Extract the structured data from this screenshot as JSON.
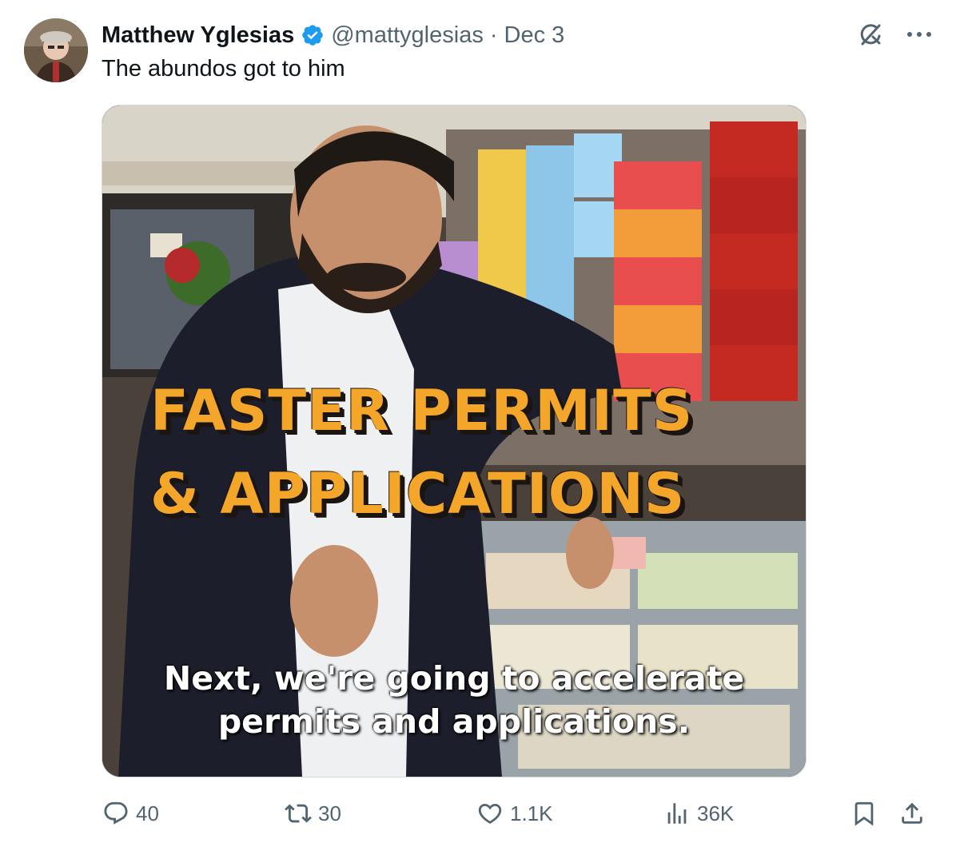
{
  "tweet": {
    "author_name": "Matthew Yglesias",
    "handle": "@mattyglesias",
    "separator": "·",
    "date": "Dec 3",
    "text": "The abundos got to him"
  },
  "media": {
    "caption_line1": "FASTER PERMITS",
    "caption_line2": "& APPLICATIONS",
    "subtitle_line1": "Next, we're going to accelerate",
    "subtitle_line2": "permits and applications."
  },
  "actions": {
    "replies": "40",
    "reposts": "30",
    "likes": "1.1K",
    "views": "36K"
  },
  "icons": {
    "verified": "verified-badge-icon",
    "grok": "grok-icon",
    "more": "more-icon",
    "reply": "reply-icon",
    "repost": "repost-icon",
    "like": "heart-icon",
    "views": "views-icon",
    "bookmark": "bookmark-icon",
    "share": "share-icon"
  },
  "colors": {
    "text_primary": "#0f1419",
    "text_secondary": "#536471",
    "verified_blue": "#1d9bf0",
    "caption_orange": "#f4a62a"
  }
}
